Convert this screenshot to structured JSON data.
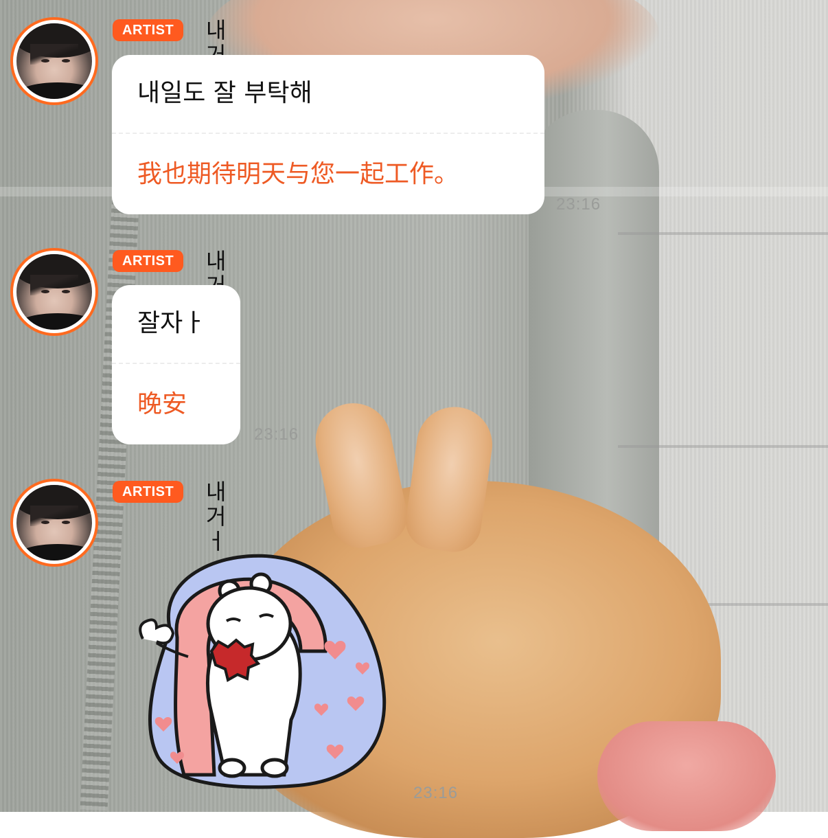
{
  "messages": [
    {
      "badge": "ARTIST",
      "sender": "내거ㅓ",
      "original": "내일도 잘 부탁해",
      "translation": "我也期待明天与您一起工作。",
      "time": "23:16"
    },
    {
      "badge": "ARTIST",
      "sender": "내거ㅓ",
      "original": "잘자ㅏ",
      "translation": "晚安",
      "time": "23:16"
    },
    {
      "badge": "ARTIST",
      "sender": "내거ㅓ",
      "sticker": "sleepy-bear-in-blanket-sticker",
      "time": "23:16"
    }
  ],
  "colors": {
    "accent": "#ff5a1f",
    "translation_text": "#ee5a24",
    "bubble": "#ffffff",
    "timestamp": "#9a9c99"
  }
}
